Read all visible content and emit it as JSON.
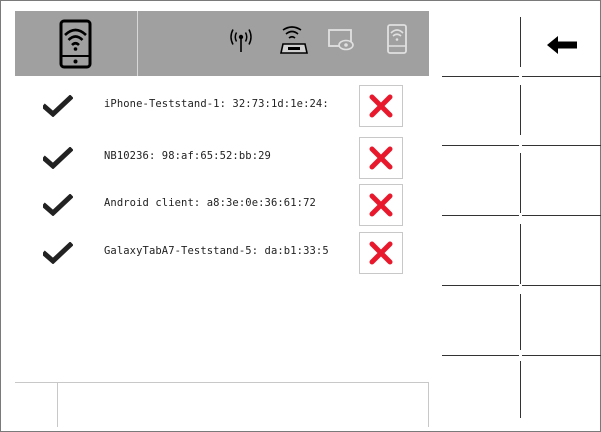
{
  "colors": {
    "topbar": "#a0a0a0",
    "delete": "#e8192c",
    "check": "#222222"
  },
  "status_icons": [
    "wifi-tablet-icon",
    "antenna-icon",
    "router-icon",
    "screen-view-icon",
    "wifi-device-icon"
  ],
  "devices": [
    {
      "label": "iPhone-Teststand-1: 32:73:1d:1e:24:"
    },
    {
      "label": "NB10236: 98:af:65:52:bb:29"
    },
    {
      "label": "Android client: a8:3e:0e:36:61:72"
    },
    {
      "label": "GalaxyTabA7-Teststand-5: da:b1:33:5"
    }
  ],
  "side_buttons": [
    "back-arrow-icon"
  ]
}
